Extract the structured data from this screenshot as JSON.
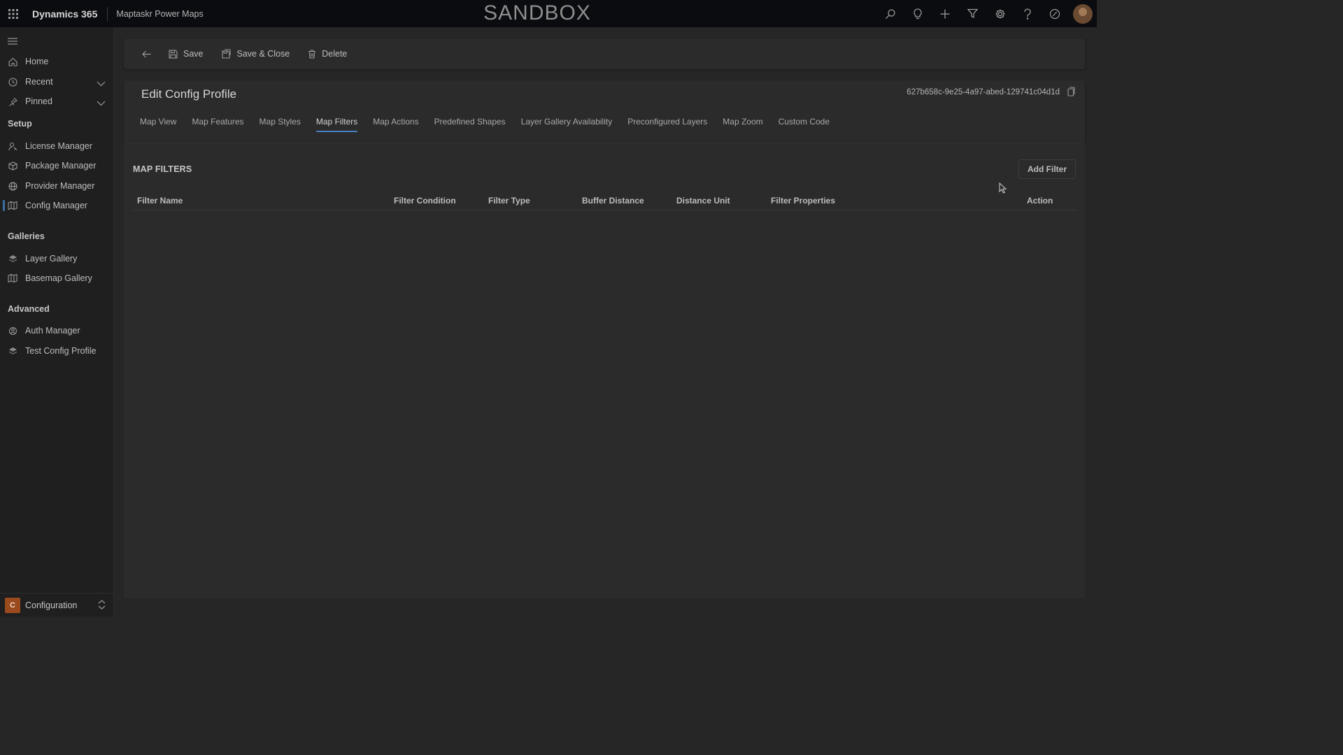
{
  "topbar": {
    "app_name": "Dynamics 365",
    "app_subtitle": "Maptaskr Power Maps",
    "environment_label": "SANDBOX",
    "icons": [
      "search-icon",
      "lightbulb-icon",
      "plus-icon",
      "filter-icon",
      "gear-icon",
      "help-icon",
      "copilot-icon"
    ]
  },
  "sidebar": {
    "top_items": [
      {
        "label": "Home",
        "icon": "home-icon"
      },
      {
        "label": "Recent",
        "icon": "clock-icon"
      },
      {
        "label": "Pinned",
        "icon": "pin-icon"
      }
    ],
    "sections": [
      {
        "title": "Setup",
        "items": [
          {
            "label": "License Manager",
            "icon": "license-icon"
          },
          {
            "label": "Package Manager",
            "icon": "package-icon"
          },
          {
            "label": "Provider Manager",
            "icon": "globe-icon"
          },
          {
            "label": "Config Manager",
            "icon": "map-icon",
            "active": true
          }
        ]
      },
      {
        "title": "Galleries",
        "items": [
          {
            "label": "Layer Gallery",
            "icon": "layers-icon"
          },
          {
            "label": "Basemap Gallery",
            "icon": "basemap-icon"
          }
        ]
      },
      {
        "title": "Advanced",
        "items": [
          {
            "label": "Auth Manager",
            "icon": "auth-icon"
          },
          {
            "label": "Test Config Profile",
            "icon": "test-layers-icon"
          }
        ]
      }
    ],
    "area": {
      "badge": "C",
      "label": "Configuration"
    }
  },
  "commandbar": {
    "save": "Save",
    "save_close": "Save & Close",
    "delete": "Delete"
  },
  "header": {
    "title": "Edit Config Profile",
    "record_id": "627b658c-9e25-4a97-abed-129741c04d1d"
  },
  "tabs": [
    {
      "label": "Map View"
    },
    {
      "label": "Map Features"
    },
    {
      "label": "Map Styles"
    },
    {
      "label": "Map Filters",
      "active": true
    },
    {
      "label": "Map Actions"
    },
    {
      "label": "Predefined Shapes"
    },
    {
      "label": "Layer Gallery Availability"
    },
    {
      "label": "Preconfigured Layers"
    },
    {
      "label": "Map Zoom"
    },
    {
      "label": "Custom Code"
    }
  ],
  "filters": {
    "section_title": "MAP FILTERS",
    "add_button": "Add Filter",
    "columns": [
      "Filter Name",
      "Filter Condition",
      "Filter Type",
      "Buffer Distance",
      "Distance Unit",
      "Filter Properties",
      "Action"
    ],
    "rows": []
  },
  "colors": {
    "topbar_bg": "#0b0c10",
    "sidebar_bg": "#1f1f1f",
    "page_bg": "#262626",
    "card_bg": "#2b2b2b",
    "accent": "#4a82c2",
    "area_badge": "#9b4a1e"
  }
}
